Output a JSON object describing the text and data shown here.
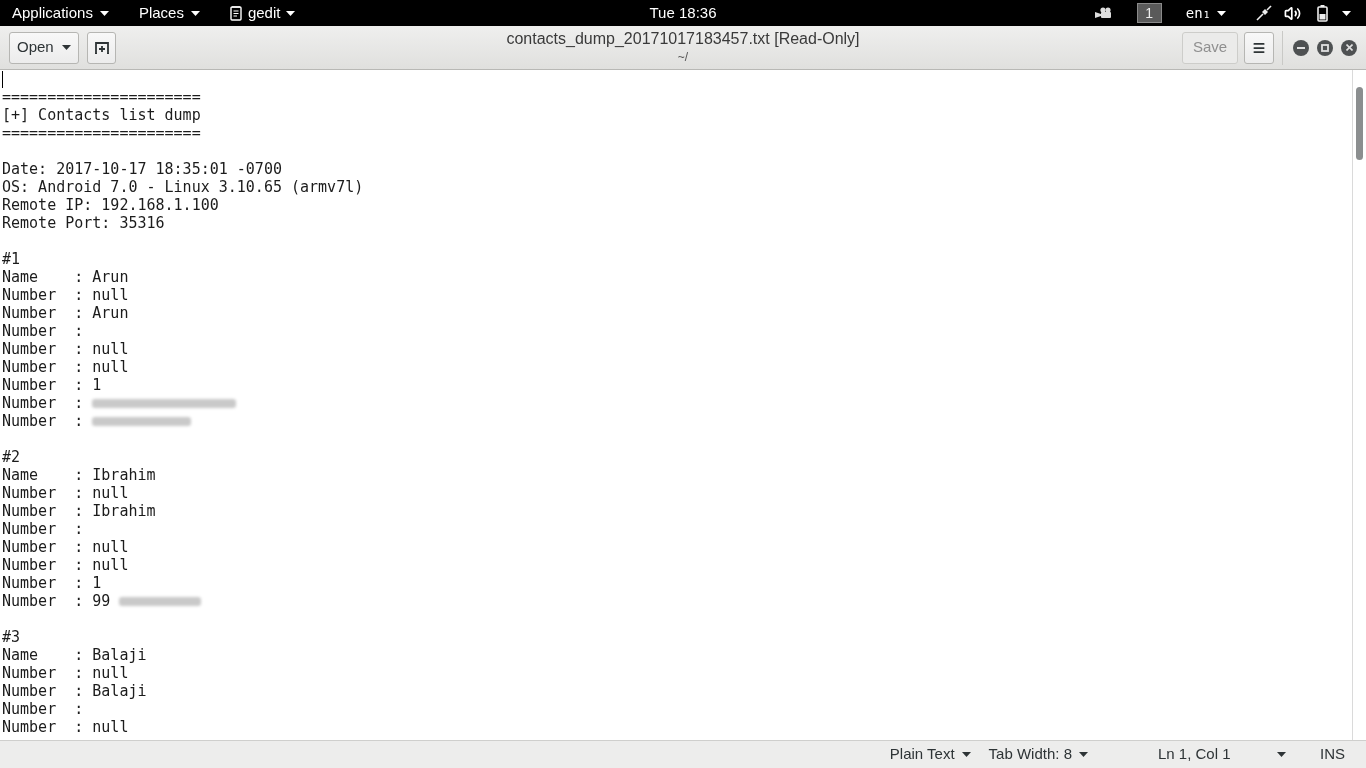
{
  "top_bar": {
    "menus": [
      {
        "kind": "menu",
        "label": "Applications"
      },
      {
        "kind": "menu",
        "label": "Places"
      },
      {
        "kind": "app",
        "label": "gedit"
      }
    ],
    "clock": "Tue 18:36",
    "workspace": "1",
    "keyboard_layout": "en₁"
  },
  "header_bar": {
    "open_button": "Open",
    "title": "contacts_dump_20171017183457.txt [Read-Only]",
    "subtitle": "~/",
    "save_button": {
      "label": "Save",
      "disabled": true
    }
  },
  "document": {
    "lines": [
      {
        "kind": "cursor"
      },
      {
        "kind": "text",
        "text": "======================"
      },
      {
        "kind": "text",
        "text": "[+] Contacts list dump"
      },
      {
        "kind": "text",
        "text": "======================"
      },
      {
        "kind": "blank"
      },
      {
        "kind": "text",
        "text": "Date: 2017-10-17 18:35:01 -0700"
      },
      {
        "kind": "text",
        "text": "OS: Android 7.0 - Linux 3.10.65 (armv7l)"
      },
      {
        "kind": "text",
        "text": "Remote IP: 192.168.1.100"
      },
      {
        "kind": "text",
        "text": "Remote Port: 35316"
      },
      {
        "kind": "blank"
      },
      {
        "kind": "text",
        "text": "#1"
      },
      {
        "kind": "text",
        "text": "Name    : Arun"
      },
      {
        "kind": "text",
        "text": "Number  : null"
      },
      {
        "kind": "text",
        "text": "Number  : Arun"
      },
      {
        "kind": "text",
        "text": "Number  :"
      },
      {
        "kind": "text",
        "text": "Number  : null"
      },
      {
        "kind": "text",
        "text": "Number  : null"
      },
      {
        "kind": "text",
        "text": "Number  : 1"
      },
      {
        "kind": "redacted",
        "text": "Number  :"
      },
      {
        "kind": "redacted",
        "text": "Number  :"
      },
      {
        "kind": "blank"
      },
      {
        "kind": "text",
        "text": "#2"
      },
      {
        "kind": "text",
        "text": "Name    : Ibrahim"
      },
      {
        "kind": "text",
        "text": "Number  : null"
      },
      {
        "kind": "text",
        "text": "Number  : Ibrahim"
      },
      {
        "kind": "text",
        "text": "Number  :"
      },
      {
        "kind": "text",
        "text": "Number  : null"
      },
      {
        "kind": "text",
        "text": "Number  : null"
      },
      {
        "kind": "text",
        "text": "Number  : 1"
      },
      {
        "kind": "redacted",
        "text": "Number  : 99"
      },
      {
        "kind": "blank"
      },
      {
        "kind": "text",
        "text": "#3"
      },
      {
        "kind": "text",
        "text": "Name    : Balaji"
      },
      {
        "kind": "text",
        "text": "Number  : null"
      },
      {
        "kind": "text",
        "text": "Number  : Balaji"
      },
      {
        "kind": "text",
        "text": "Number  :"
      },
      {
        "kind": "text",
        "text": "Number  : null"
      }
    ]
  },
  "status_bar": {
    "language": "Plain Text",
    "tab_width": "Tab Width: 8",
    "position": "Ln 1, Col 1",
    "mode": "INS"
  }
}
